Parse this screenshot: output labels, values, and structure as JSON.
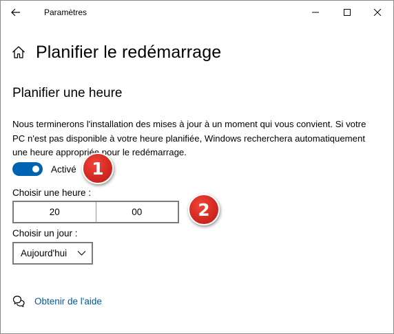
{
  "window": {
    "title": "Paramètres",
    "controls": [
      "minimize",
      "maximize",
      "close"
    ]
  },
  "page": {
    "title": "Planifier le redémarrage",
    "icon": "home-icon"
  },
  "section": {
    "title": "Planifier une heure",
    "description": "Nous terminerons l'installation des mises à jour à un moment qui vous convient. Si votre PC n'est pas disponible à votre heure planifiée, Windows recherchera automatiquement une heure appropriée pour le redémarrage."
  },
  "toggle": {
    "label": "Activé",
    "state": "on",
    "accent": "#0063b1"
  },
  "time": {
    "label": "Choisir une heure :",
    "hour": "20",
    "minute": "00"
  },
  "day": {
    "label": "Choisir un jour :",
    "value": "Aujourd'hui"
  },
  "help": {
    "label": "Obtenir de l'aide",
    "color": "#005a9e"
  },
  "annotations": {
    "badge1": "1",
    "badge2": "2",
    "color": "#d42a22"
  }
}
